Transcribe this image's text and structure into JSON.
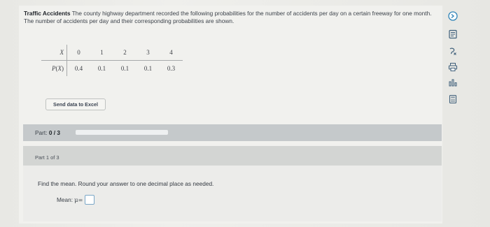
{
  "problem": {
    "title": "Traffic Accidents",
    "body": "The county highway department recorded the following probabilities for the number of accidents per day on a certain freeway for one month. The number of accidents per day and their corresponding probabilities are shown."
  },
  "table": {
    "x_header": "X",
    "px_header_var": "P",
    "px_header_open": "(",
    "px_header_arg": "X",
    "px_header_close": ")",
    "x_values": [
      "0",
      "1",
      "2",
      "3",
      "4"
    ],
    "p_values": [
      "0.4",
      "0.1",
      "0.1",
      "0.1",
      "0.3"
    ]
  },
  "excel_button": {
    "label": "Send data to Excel"
  },
  "part_progress": {
    "label": "Part:",
    "value_text": "0 / 3",
    "completed_fraction": 0
  },
  "step": {
    "header": "Part 1 of 3",
    "instruction": "Find the mean. Round your answer to one decimal place as needed.",
    "mean_label": "Mean:",
    "mu_symbol": "μ=",
    "answer_value": ""
  },
  "toolbar": {
    "icons": [
      "collapse-icon",
      "book-icon",
      "glossary-icon",
      "print-icon",
      "chart-icon",
      "calculator-icon"
    ]
  },
  "colors": {
    "background": "#e8e8e4",
    "part_bar": "#c5c9cb",
    "step_header": "#d3d5d3",
    "accent": "#2f84b8"
  }
}
